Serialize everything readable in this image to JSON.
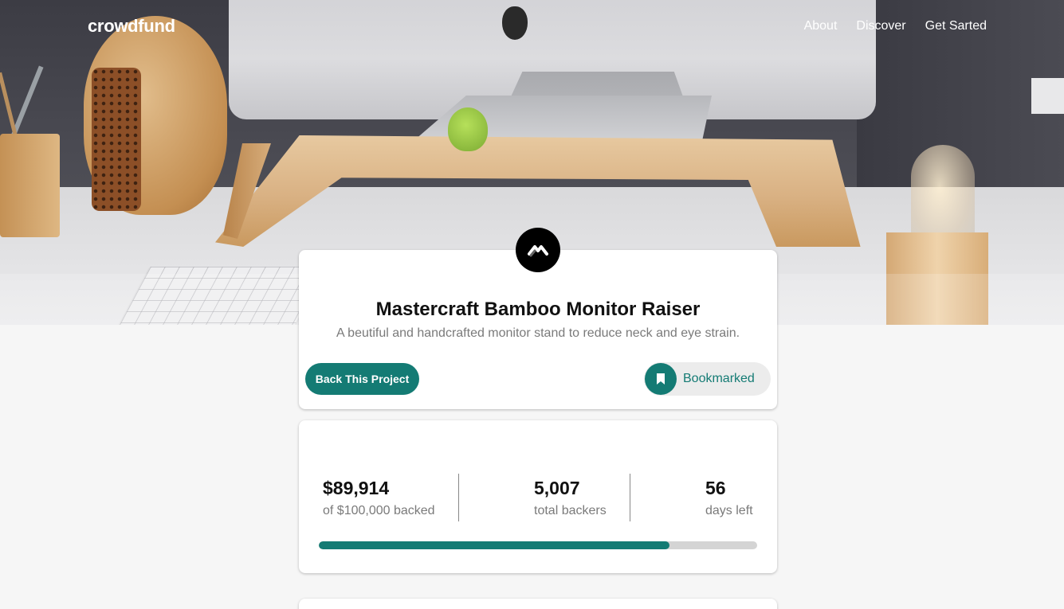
{
  "brand": {
    "logo_text": "crowdfund"
  },
  "nav": {
    "items": [
      {
        "label": "About"
      },
      {
        "label": "Discover"
      },
      {
        "label": "Get Sarted"
      }
    ]
  },
  "project": {
    "logo_icon": "mastercraft-logo-icon",
    "title": "Mastercraft Bamboo Monitor Raiser",
    "description": "A beutiful and handcrafted monitor stand to reduce neck and eye strain.",
    "back_button_label": "Back This Project",
    "bookmark_label": "Bookmarked",
    "bookmark_icon": "bookmark-icon"
  },
  "stats": {
    "backed_amount": "$89,914",
    "backed_label": "of $100,000 backed",
    "backers_count": "5,007",
    "backers_label": "total backers",
    "days_left": "56",
    "days_label": "days left",
    "progress_fraction": 0.8
  },
  "colors": {
    "accent": "#147b74",
    "accent_dark": "#0e5a55",
    "progress_track": "#d4d4d4",
    "page_background": "#f6f6f6"
  }
}
